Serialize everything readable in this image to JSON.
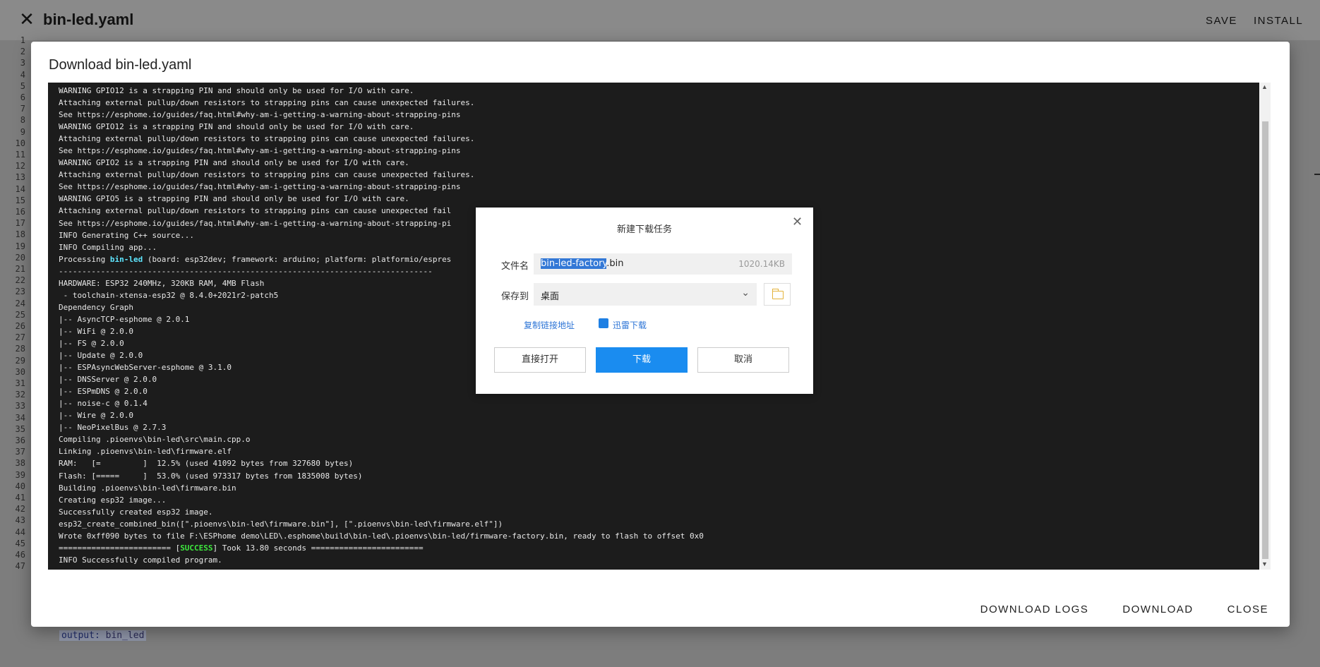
{
  "header": {
    "title": "bin-led.yaml",
    "save_label": "SAVE",
    "install_label": "INSTALL"
  },
  "editor": {
    "line_numbers": [
      "1",
      "2",
      "3",
      "4",
      "5",
      "6",
      "7",
      "8",
      "9",
      "10",
      "11",
      "12",
      "13",
      "14",
      "15",
      "16",
      "17",
      "18",
      "19",
      "20",
      "21",
      "22",
      "23",
      "24",
      "25",
      "26",
      "27",
      "28",
      "29",
      "30",
      "31",
      "32",
      "33",
      "34",
      "35",
      "36",
      "37",
      "38",
      "39",
      "40",
      "41",
      "42",
      "43",
      "44",
      "45",
      "46",
      "47"
    ],
    "line45_key": "output:",
    "line45_value": "bin_led"
  },
  "dialog": {
    "title": "Download bin-led.yaml",
    "actions": [
      "DOWNLOAD LOGS",
      "DOWNLOAD",
      "CLOSE"
    ],
    "log_lines": [
      "WARNING GPIO12 is a strapping PIN and should only be used for I/O with care.",
      "Attaching external pullup/down resistors to strapping pins can cause unexpected failures.",
      "See https://esphome.io/guides/faq.html#why-am-i-getting-a-warning-about-strapping-pins",
      "WARNING GPIO12 is a strapping PIN and should only be used for I/O with care.",
      "Attaching external pullup/down resistors to strapping pins can cause unexpected failures.",
      "See https://esphome.io/guides/faq.html#why-am-i-getting-a-warning-about-strapping-pins",
      "WARNING GPIO2 is a strapping PIN and should only be used for I/O with care.",
      "Attaching external pullup/down resistors to strapping pins can cause unexpected failures.",
      "See https://esphome.io/guides/faq.html#why-am-i-getting-a-warning-about-strapping-pins",
      "WARNING GPIO5 is a strapping PIN and should only be used for I/O with care.",
      "Attaching external pullup/down resistors to strapping pins can cause unexpected fail",
      "See https://esphome.io/guides/faq.html#why-am-i-getting-a-warning-about-strapping-pi",
      "INFO Generating C++ source...",
      "INFO Compiling app...",
      {
        "parts": [
          "Processing ",
          {
            "cyan": "bin-led"
          },
          " (board: esp32dev; framework: arduino; platform: platformio/espres"
        ]
      },
      "--------------------------------------------------------------------------------",
      "HARDWARE: ESP32 240MHz, 320KB RAM, 4MB Flash",
      " - toolchain-xtensa-esp32 @ 8.4.0+2021r2-patch5",
      "Dependency Graph",
      "|-- AsyncTCP-esphome @ 2.0.1",
      "|-- WiFi @ 2.0.0",
      "|-- FS @ 2.0.0",
      "|-- Update @ 2.0.0",
      "|-- ESPAsyncWebServer-esphome @ 3.1.0",
      "|-- DNSServer @ 2.0.0",
      "|-- ESPmDNS @ 2.0.0",
      "|-- noise-c @ 0.1.4",
      "|-- Wire @ 2.0.0",
      "|-- NeoPixelBus @ 2.7.3",
      "Compiling .pioenvs\\bin-led\\src\\main.cpp.o",
      "Linking .pioenvs\\bin-led\\firmware.elf",
      "RAM:   [=         ]  12.5% (used 41092 bytes from 327680 bytes)",
      "Flash: [=====     ]  53.0% (used 973317 bytes from 1835008 bytes)",
      "Building .pioenvs\\bin-led\\firmware.bin",
      "Creating esp32 image...",
      "Successfully created esp32 image.",
      "esp32_create_combined_bin([\".pioenvs\\bin-led\\firmware.bin\"], [\".pioenvs\\bin-led\\firmware.elf\"])",
      "Wrote 0xff090 bytes to file F:\\ESPhome demo\\LED\\.esphome\\build\\bin-led\\.pioenvs\\bin-led/firmware-factory.bin, ready to flash to offset 0x0",
      {
        "parts": [
          "======================== [",
          {
            "green": "SUCCESS"
          },
          "] Took 13.80 seconds ========================"
        ]
      },
      "INFO Successfully compiled program."
    ]
  },
  "popup": {
    "title": "新建下载任务",
    "filename_label": "文件名",
    "filename_selected": "bin-led-factory",
    "filename_ext": ".bin",
    "filesize": "1020.14KB",
    "saveto_label": "保存到",
    "saveto_value": "桌面",
    "copy_link_label": "复制链接地址",
    "xunlei_label": "迅雷下载",
    "open_directly_label": "直接打开",
    "download_label": "下载",
    "cancel_label": "取消",
    "icon_names": [
      "close-icon",
      "chevron-down-icon",
      "folder-icon",
      "xunlei-icon"
    ]
  }
}
